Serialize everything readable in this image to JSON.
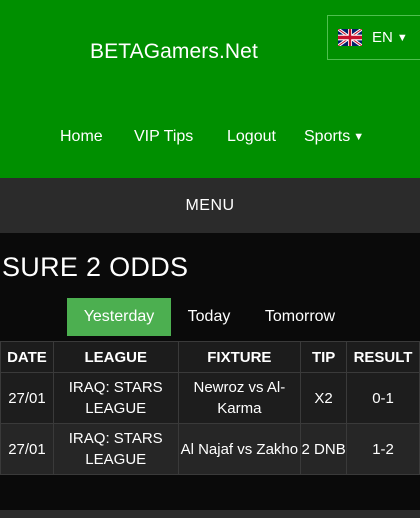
{
  "site": {
    "title": "BETAGamers.Net"
  },
  "language": {
    "label": "EN",
    "flag_icon": "uk-flag-icon",
    "caret_icon": "caret-down-icon"
  },
  "nav": {
    "items": [
      {
        "label": "Home"
      },
      {
        "label": "VIP Tips"
      },
      {
        "label": "Logout"
      },
      {
        "label": "Sports",
        "has_dropdown": true
      }
    ]
  },
  "menu": {
    "label": "MENU"
  },
  "page": {
    "title": "SURE 2 ODDS"
  },
  "tabs": [
    {
      "label": "Yesterday",
      "active": true
    },
    {
      "label": "Today",
      "active": false
    },
    {
      "label": "Tomorrow",
      "active": false
    }
  ],
  "table": {
    "headers": [
      "DATE",
      "LEAGUE",
      "FIXTURE",
      "TIP",
      "RESULT"
    ],
    "rows": [
      {
        "date": "27/01",
        "league": "IRAQ: STARS LEAGUE",
        "fixture": "Newroz vs Al-Karma",
        "tip": "X2",
        "result": "0-1"
      },
      {
        "date": "27/01",
        "league": "IRAQ: STARS LEAGUE",
        "fixture": "Al Najaf vs Zakho",
        "tip": "2 DNB",
        "result": "1-2"
      }
    ]
  },
  "colors": {
    "header_bg": "#008f00",
    "accent_tab": "#4caf50",
    "bar_bg": "#2b2b2b",
    "page_bg": "#0a0a0a"
  }
}
